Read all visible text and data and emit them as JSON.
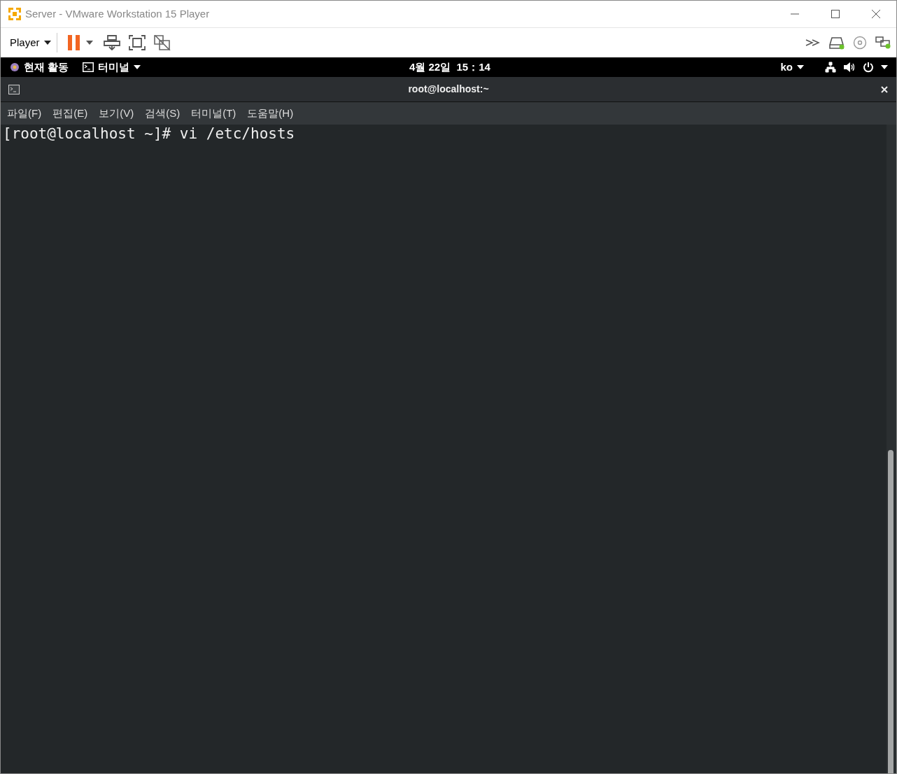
{
  "window": {
    "title": "Server - VMware Workstation 15 Player"
  },
  "toolbar": {
    "player_menu": "Player"
  },
  "top_bar": {
    "activities": "현재 활동",
    "app_menu": "터미널",
    "clock": "4월 22일  15：14",
    "language": "ko"
  },
  "terminal": {
    "title": "root@localhost:~",
    "menu": [
      "파일(F)",
      "편집(E)",
      "보기(V)",
      "검색(S)",
      "터미널(T)",
      "도움말(H)"
    ],
    "lines": [
      "[root@localhost ~]# vi /etc/hosts"
    ]
  }
}
